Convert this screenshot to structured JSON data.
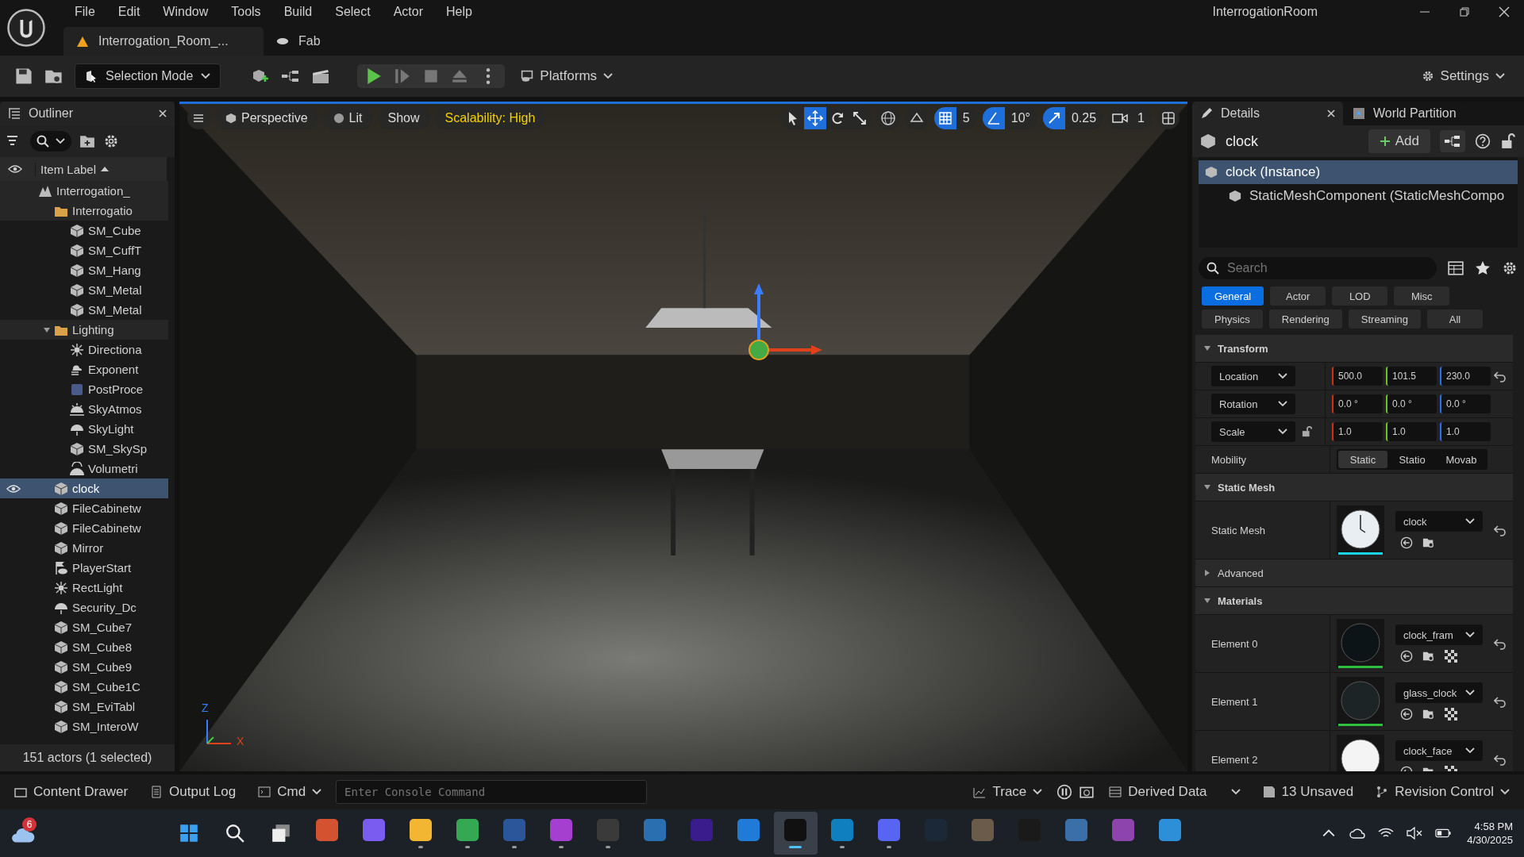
{
  "title": "InterrogationRoom",
  "menu": [
    "File",
    "Edit",
    "Window",
    "Tools",
    "Build",
    "Select",
    "Actor",
    "Help"
  ],
  "doc_tabs": [
    {
      "label": "Interrogation_Room_...",
      "kind": "level",
      "selected": true
    },
    {
      "label": "Fab",
      "kind": "store",
      "selected": false
    }
  ],
  "toolbar": {
    "mode": "Selection Mode",
    "platforms": "Platforms",
    "settings": "Settings"
  },
  "outliner": {
    "title": "Outliner",
    "column": "Item Label",
    "status": "151 actors (1 selected)",
    "items": [
      {
        "label": "Interrogation_",
        "kind": "level",
        "selected": false,
        "children": [
          {
            "label": "Interrogatio",
            "kind": "folder",
            "selected": false,
            "children": [
              {
                "label": "SM_Cube",
                "kind": "mesh",
                "selected": false
              },
              {
                "label": "SM_CuffT",
                "kind": "mesh",
                "selected": false
              },
              {
                "label": "SM_Hang",
                "kind": "mesh",
                "selected": false
              },
              {
                "label": "SM_Metal",
                "kind": "mesh",
                "selected": false
              },
              {
                "label": "SM_Metal",
                "kind": "mesh",
                "selected": false
              }
            ]
          },
          {
            "label": "Lighting",
            "kind": "folder",
            "expanded": true,
            "selected": false,
            "children": [
              {
                "label": "Directiona",
                "kind": "sun",
                "selected": false
              },
              {
                "label": "Exponent",
                "kind": "fog",
                "selected": false
              },
              {
                "label": "PostProce",
                "kind": "volume",
                "selected": false
              },
              {
                "label": "SkyAtmos",
                "kind": "sky",
                "selected": false
              },
              {
                "label": "SkyLight",
                "kind": "dome",
                "selected": false
              },
              {
                "label": "SM_SkySp",
                "kind": "mesh",
                "selected": false
              },
              {
                "label": "Volumetri",
                "kind": "cloud",
                "selected": false
              }
            ]
          },
          {
            "label": "clock",
            "kind": "mesh",
            "selected": true
          },
          {
            "label": "FileCabinetw",
            "kind": "mesh",
            "selected": false
          },
          {
            "label": "FileCabinetw",
            "kind": "mesh",
            "selected": false
          },
          {
            "label": "Mirror",
            "kind": "mesh",
            "selected": false
          },
          {
            "label": "PlayerStart",
            "kind": "player",
            "selected": false
          },
          {
            "label": "RectLight",
            "kind": "sun",
            "selected": false
          },
          {
            "label": "Security_Dc",
            "kind": "dome",
            "selected": false
          },
          {
            "label": "SM_Cube7",
            "kind": "mesh",
            "selected": false
          },
          {
            "label": "SM_Cube8",
            "kind": "mesh",
            "selected": false
          },
          {
            "label": "SM_Cube9",
            "kind": "mesh",
            "selected": false
          },
          {
            "label": "SM_Cube1C",
            "kind": "mesh",
            "selected": false
          },
          {
            "label": "SM_EviTabl",
            "kind": "mesh",
            "selected": false
          },
          {
            "label": "SM_InteroW",
            "kind": "mesh",
            "selected": false
          }
        ]
      }
    ]
  },
  "viewport": {
    "perspective": "Perspective",
    "lit": "Lit",
    "show": "Show",
    "scalability": "Scalability: High",
    "tools": [
      {
        "kind": "select",
        "selected": false
      },
      {
        "kind": "move",
        "selected": true
      },
      {
        "kind": "rotate",
        "selected": false
      },
      {
        "kind": "scale",
        "selected": false
      }
    ],
    "grid": "5",
    "angle": "10°",
    "scale": "0.25",
    "camera": "1",
    "axis_x": "X",
    "axis_z": "Z"
  },
  "details": {
    "tabs": [
      {
        "label": "Details",
        "selected": true
      },
      {
        "label": "World Partition",
        "selected": false
      }
    ],
    "actor": "clock",
    "add": "Add",
    "components": [
      {
        "label": "clock (Instance)",
        "selected": true
      },
      {
        "label": "StaticMeshComponent (StaticMeshCompo",
        "selected": false
      }
    ],
    "search": {
      "placeholder": "Search"
    },
    "filters": [
      [
        {
          "label": "General",
          "selected": true
        },
        {
          "label": "Actor",
          "selected": false
        },
        {
          "label": "LOD",
          "selected": false
        },
        {
          "label": "Misc",
          "selected": false
        }
      ],
      [
        {
          "label": "Physics",
          "selected": false
        },
        {
          "label": "Rendering",
          "selected": false
        },
        {
          "label": "Streaming",
          "selected": false
        },
        {
          "label": "All",
          "selected": false
        }
      ]
    ],
    "sections": [
      {
        "title": "Transform",
        "kind": "transform",
        "expanded": true,
        "rows": [
          {
            "label": "Location",
            "values": [
              "500.0",
              "101.5",
              "230.0"
            ]
          },
          {
            "label": "Rotation",
            "values": [
              "0.0 °",
              "0.0 °",
              "0.0 °"
            ]
          },
          {
            "label": "Scale",
            "values": [
              "1.0",
              "1.0",
              "1.0"
            ]
          }
        ],
        "mobility": {
          "label": "Mobility",
          "options": [
            {
              "label": "Static",
              "selected": true
            },
            {
              "label": "Statio",
              "selected": false
            },
            {
              "label": "Movab",
              "selected": false
            }
          ]
        }
      },
      {
        "title": "Static Mesh",
        "kind": "assets",
        "expanded": true,
        "rows": [
          {
            "label": "Static Mesh",
            "asset": "clock",
            "kind": "clock"
          }
        ]
      },
      {
        "title": "Advanced",
        "expanded": false
      },
      {
        "title": "Materials",
        "kind": "assets",
        "expanded": true,
        "rows": [
          {
            "label": "Element 0",
            "asset": "clock_fram",
            "kind": "dark"
          },
          {
            "label": "Element 1",
            "asset": "glass_clock",
            "kind": "glass"
          },
          {
            "label": "Element 2",
            "asset": "clock_face",
            "kind": "white"
          }
        ]
      }
    ]
  },
  "bottom": {
    "content": "Content Drawer",
    "output": "Output Log",
    "cmd": "Cmd",
    "console": {
      "placeholder": "Enter Console Command"
    },
    "trace": "Trace",
    "derived": "Derived Data",
    "unsaved": "13 Unsaved",
    "revision": "Revision Control"
  },
  "taskbar": {
    "weather_badge": "6",
    "time": "4:58 PM",
    "date": "4/30/2025",
    "apps": [
      {
        "color": "#d35230",
        "running": false,
        "selected": false
      },
      {
        "color": "#7a5cf0",
        "running": false,
        "selected": false
      },
      {
        "color": "#f2b632",
        "running": true,
        "selected": false
      },
      {
        "color": "#34a853",
        "running": true,
        "selected": false
      },
      {
        "color": "#2b579a",
        "running": true,
        "selected": false
      },
      {
        "color": "#a43fd0",
        "running": true,
        "selected": false
      },
      {
        "color": "#3a3a3a",
        "running": true,
        "selected": false
      },
      {
        "color": "#2a6fb0",
        "running": false,
        "selected": false
      },
      {
        "color": "#3b1c8c",
        "running": false,
        "selected": false
      },
      {
        "color": "#1f7ad8",
        "running": false,
        "selected": false
      },
      {
        "color": "#111111",
        "running": true,
        "selected": true
      },
      {
        "color": "#0f7fbf",
        "running": true,
        "selected": false
      },
      {
        "color": "#5865f2",
        "running": true,
        "selected": false
      },
      {
        "color": "#1b2838",
        "running": false,
        "selected": false
      },
      {
        "color": "#6b5b4b",
        "running": false,
        "selected": false
      },
      {
        "color": "#1a1a1a",
        "running": false,
        "selected": false
      },
      {
        "color": "#3b6fa8",
        "running": false,
        "selected": false
      },
      {
        "color": "#8e44ad",
        "running": false,
        "selected": false
      },
      {
        "color": "#2d8fd8",
        "running": false,
        "selected": false
      }
    ]
  }
}
